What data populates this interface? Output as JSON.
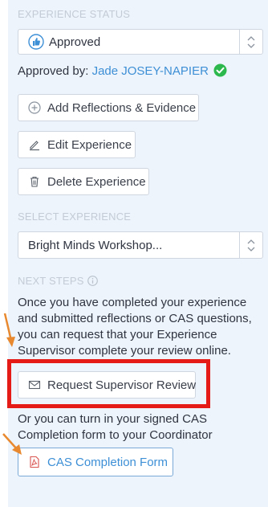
{
  "experience_status": {
    "label": "EXPERIENCE STATUS",
    "value": "Approved",
    "approved_by_label": "Approved by:",
    "approver": "Jade JOSEY-NAPIER"
  },
  "actions": {
    "add_reflections": "Add Reflections & Evidence",
    "edit_experience": "Edit Experience",
    "delete_experience": "Delete Experience"
  },
  "select_experience": {
    "label": "SELECT EXPERIENCE",
    "value": "Bright Minds Workshop..."
  },
  "next_steps": {
    "label": "NEXT STEPS",
    "paragraph": "Once you have completed your experience and submitted reflections or CAS questions, you can request that your Experience Supervisor complete your review online.",
    "request_review_button": "Request Supervisor Review",
    "or_text": "Or you can turn in your signed CAS Completion form to your Coordinator",
    "cas_form_button": "CAS Completion Form"
  },
  "colors": {
    "accent": "#3d8fd6",
    "highlight": "#e41b17",
    "arrow": "#e8892f",
    "approved_check": "#2db84d"
  }
}
